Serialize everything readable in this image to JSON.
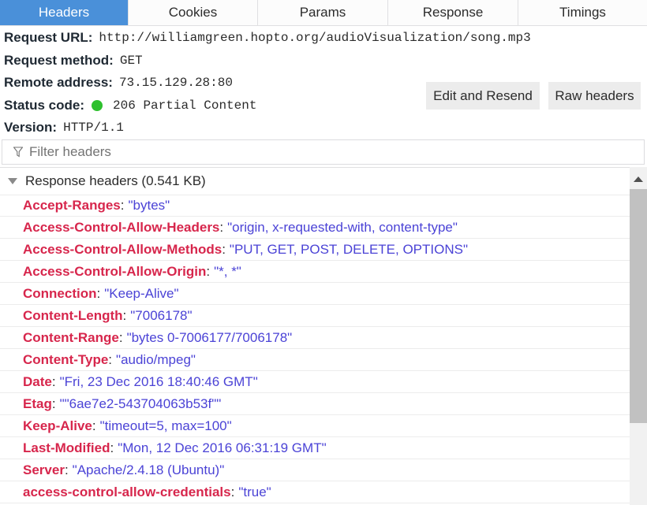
{
  "tabs": [
    {
      "label": "Headers",
      "active": true
    },
    {
      "label": "Cookies",
      "active": false
    },
    {
      "label": "Params",
      "active": false
    },
    {
      "label": "Response",
      "active": false
    },
    {
      "label": "Timings",
      "active": false
    }
  ],
  "summary": {
    "request_url_label": "Request URL:",
    "request_url": "http://williamgreen.hopto.org/audioVisualization/song.mp3",
    "method_label": "Request method:",
    "method": "GET",
    "remote_label": "Remote address:",
    "remote": "73.15.129.28:80",
    "status_label": "Status code:",
    "status": "206 Partial Content",
    "status_color": "#2ec02e",
    "version_label": "Version:",
    "version": "HTTP/1.1"
  },
  "buttons": {
    "edit_resend": "Edit and Resend",
    "raw_headers": "Raw headers"
  },
  "filter": {
    "placeholder": "Filter headers",
    "icon": "filter-icon"
  },
  "response_section": {
    "title": "Response headers (0.541 KB)"
  },
  "headers": [
    {
      "name": "Accept-Ranges",
      "value": "\"bytes\""
    },
    {
      "name": "Access-Control-Allow-Headers",
      "value": "\"origin, x-requested-with, content-type\""
    },
    {
      "name": "Access-Control-Allow-Methods",
      "value": "\"PUT, GET, POST, DELETE, OPTIONS\""
    },
    {
      "name": "Access-Control-Allow-Origin",
      "value": "\"*, *\""
    },
    {
      "name": "Connection",
      "value": "\"Keep-Alive\""
    },
    {
      "name": "Content-Length",
      "value": "\"7006178\""
    },
    {
      "name": "Content-Range",
      "value": "\"bytes 0-7006177/7006178\""
    },
    {
      "name": "Content-Type",
      "value": "\"audio/mpeg\""
    },
    {
      "name": "Date",
      "value": "\"Fri, 23 Dec 2016 18:40:46 GMT\""
    },
    {
      "name": "Etag",
      "value": "\"\"6ae7e2-543704063b53f\"\""
    },
    {
      "name": "Keep-Alive",
      "value": "\"timeout=5, max=100\""
    },
    {
      "name": "Last-Modified",
      "value": "\"Mon, 12 Dec 2016 06:31:19 GMT\""
    },
    {
      "name": "Server",
      "value": "\"Apache/2.4.18 (Ubuntu)\""
    },
    {
      "name": "access-control-allow-credentials",
      "value": "\"true\""
    }
  ],
  "colors": {
    "accent": "#4a90d9",
    "header_name": "#d7264c",
    "header_value": "#4b43d6"
  }
}
